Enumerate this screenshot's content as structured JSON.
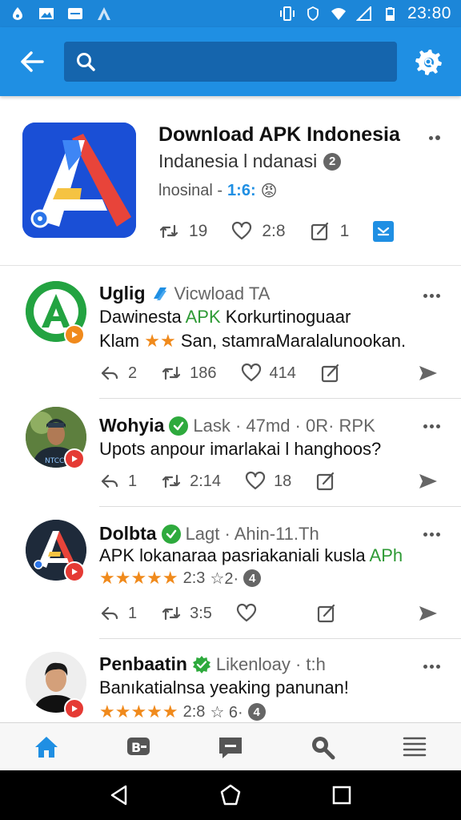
{
  "status_bar": {
    "time": "23:80",
    "left_icons": [
      "drop-icon",
      "gallery-icon",
      "battery-saver-icon",
      "app-icon"
    ],
    "right_icons": [
      "vibrate-icon",
      "shield-icon",
      "wifi-icon",
      "signal-icon",
      "battery-icon"
    ]
  },
  "app_bar": {
    "search_placeholder": "",
    "search_value": ""
  },
  "featured": {
    "title": "Download APK Indonesia",
    "subtitle": "Indanesia l ndanasi",
    "subtitle_badge": "2",
    "meta_label": "lnosinal -",
    "meta_code": "1:6:",
    "meta_emoji": "😡",
    "stats": {
      "reposts": "19",
      "likes": "2:8",
      "edits": "1"
    }
  },
  "posts": [
    {
      "name": "Uglig",
      "handle": "Vicwload TA",
      "text1_pre": "Dawinesta ",
      "text1_green": "APK",
      "text1_post": " Korkurtinoguaar",
      "text2_pre": "Klam ",
      "text2_stars": "★★",
      "text2_post": " San, stamraMaralalunookan.",
      "replies": "2",
      "reposts": "186",
      "likes": "414"
    },
    {
      "name": "Wohyia",
      "handle": "Lask · 47md · 0R· RPK",
      "text1": "Upots anpour imarlakai l hanghoos?",
      "replies": "1",
      "reposts": "2:14",
      "likes": "18"
    },
    {
      "name": "Dolbta",
      "handle": "Lagt · Ahin-11.Th",
      "text1_pre": "APK lokanaraa pasriakaniali kusla ",
      "text1_green": "APh",
      "stars": "★★★★★",
      "rating": "2:3",
      "rating_extra": "☆2·",
      "rating_badge": "4",
      "replies": "1",
      "reposts": "3:5"
    },
    {
      "name": "Penbaatin",
      "handle": "Likenloay · t:h",
      "text1": "Banıkatialnsa  yeaking panunan!",
      "stars": "★★★★★",
      "rating": "2:8",
      "rating_extra": "☆ 6·",
      "rating_badge": "4"
    }
  ],
  "colors": {
    "status_bar": "#1c86d8",
    "app_bar": "#1f8fe3",
    "accent_green": "#2e9a35",
    "star": "#f08a1c"
  }
}
